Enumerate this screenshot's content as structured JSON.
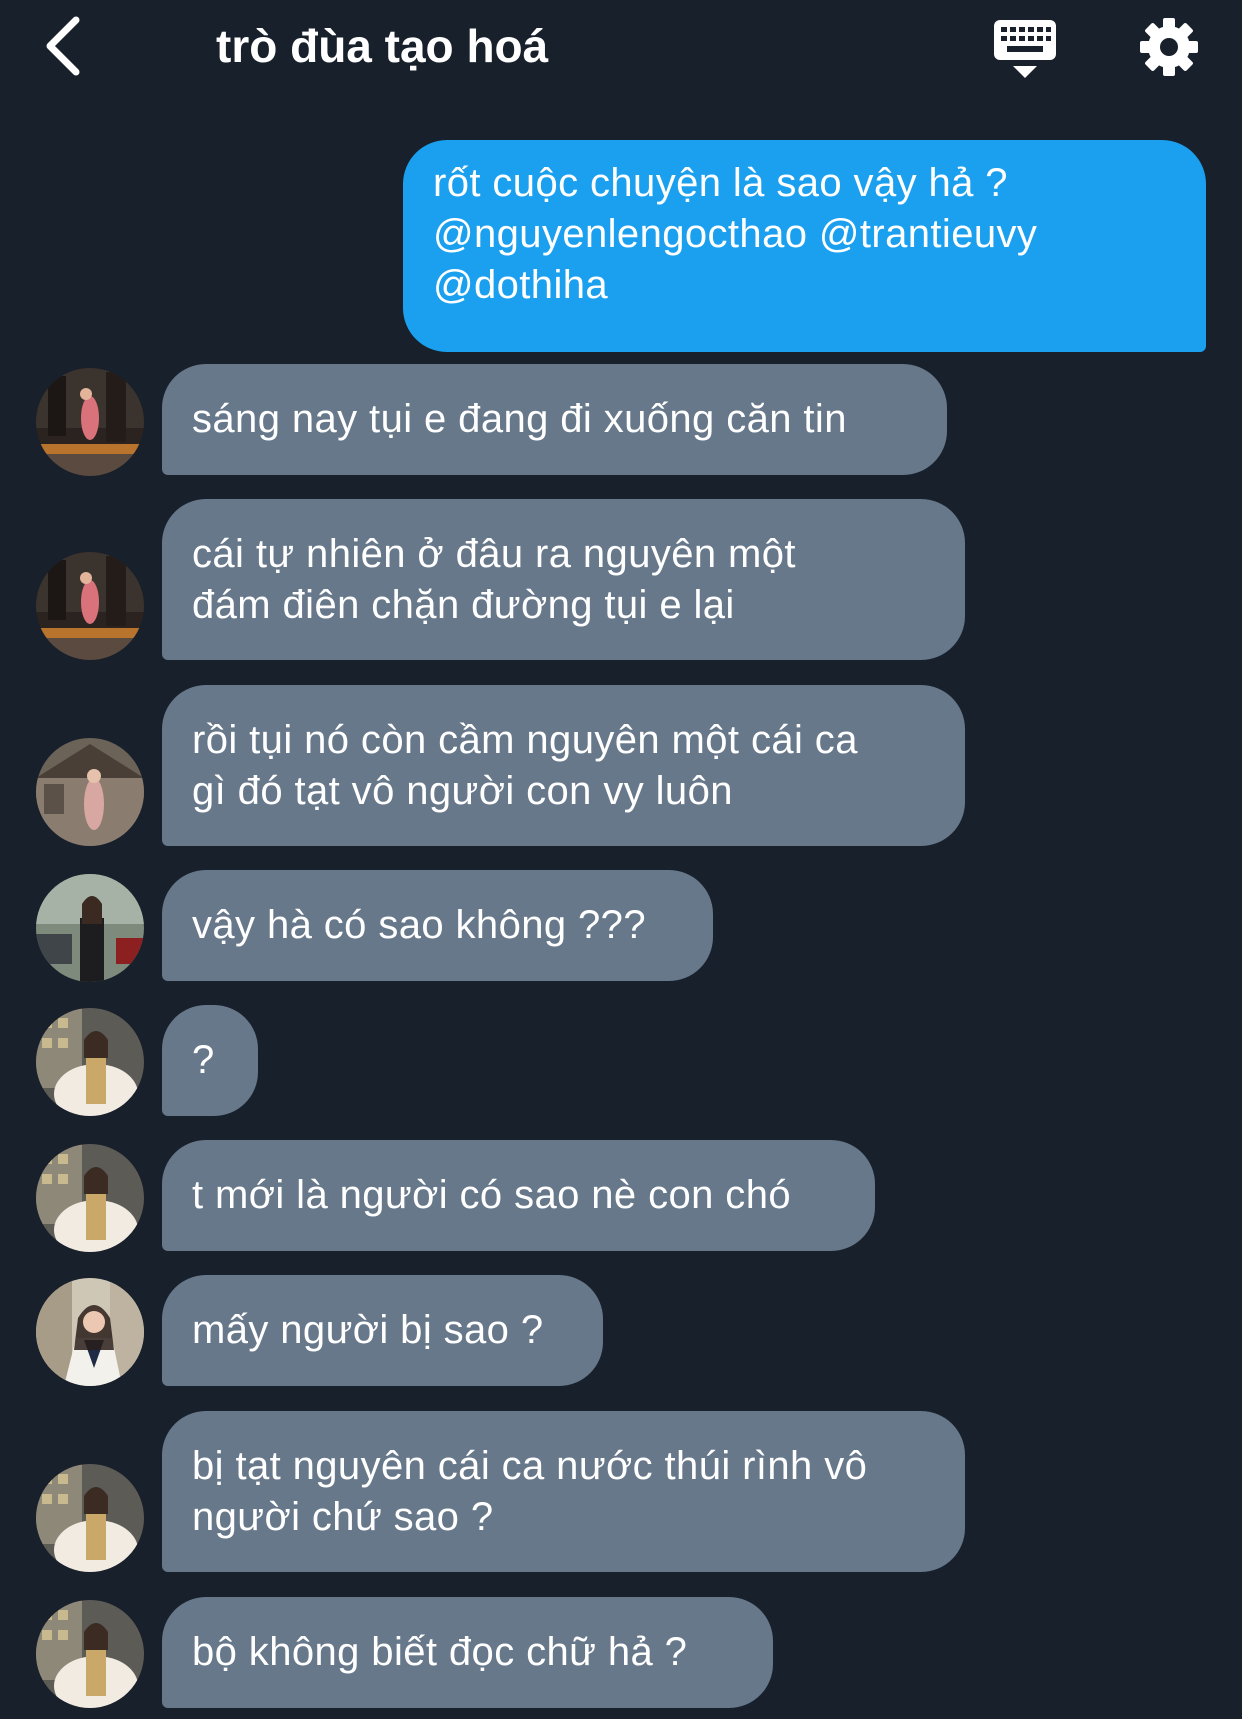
{
  "header": {
    "title": "trò đùa tạo hoá",
    "back_icon": "chevron-left-icon",
    "keyboard_icon": "keyboard-icon",
    "settings_icon": "gear-icon"
  },
  "colors": {
    "background": "#18202b",
    "outgoing_bubble": "#1ba0ef",
    "incoming_bubble": "#67788b",
    "text": "#ffffff"
  },
  "messages": [
    {
      "direction": "outgoing",
      "text": "rốt cuộc chuyện là sao vậy hả ?\n@nguyenlengocthao @trantieuvy\n@dothiha"
    },
    {
      "direction": "incoming",
      "text": "sáng nay tụi e đang đi xuống căn tin"
    },
    {
      "direction": "incoming",
      "text": "cái tự nhiên ở đâu ra nguyên một\nđám điên chặn đường tụi e lại"
    },
    {
      "direction": "incoming",
      "text": "rồi tụi nó còn cầm nguyên một cái ca\ngì đó tạt vô người con vy luôn"
    },
    {
      "direction": "incoming",
      "text": "vậy hà có sao không ???"
    },
    {
      "direction": "incoming",
      "text": "?"
    },
    {
      "direction": "incoming",
      "text": "t mới là người có sao nè con chó"
    },
    {
      "direction": "incoming",
      "text": "mấy người bị sao ?"
    },
    {
      "direction": "incoming",
      "text": "bị tạt nguyên cái ca nước thúi rình vô\nngười chứ sao ?"
    },
    {
      "direction": "incoming",
      "text": "bộ không biết đọc chữ hả ?"
    }
  ]
}
